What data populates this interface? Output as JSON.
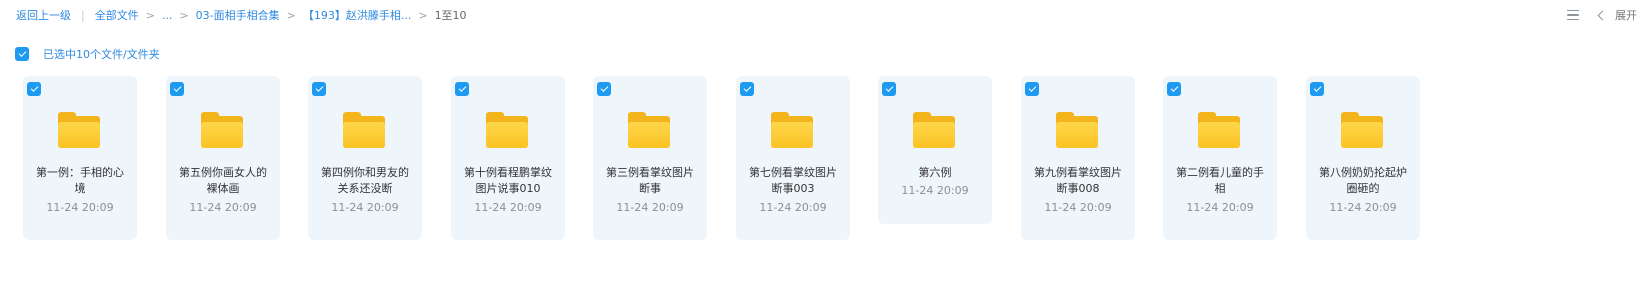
{
  "breadcrumb": {
    "back": "返回上一级",
    "divider": "|",
    "root": "全部文件",
    "ellipsis": "...",
    "level1": "03-面相手相合集",
    "level2": "【193】赵洪滕手相...",
    "sep": ">",
    "current": "1至10"
  },
  "top_right": {
    "list_icon": "list-view-icon",
    "chevron_icon": "chevron-left-icon",
    "expand_label": "展开"
  },
  "selection": {
    "checked": true,
    "label": "已选中10个文件/文件夹"
  },
  "colors": {
    "accent": "#1e9bf0",
    "link": "#2f8ae0",
    "card_bg": "#eef6fc",
    "folder": "#fbc324"
  },
  "files": [
    {
      "name": "第一例：手相的心境",
      "time": "11-24 20:09",
      "checked": true,
      "icon": "folder-icon"
    },
    {
      "name": "第五例你画女人的裸体画",
      "time": "11-24 20:09",
      "checked": true,
      "icon": "folder-icon"
    },
    {
      "name": "第四例你和男友的关系还没断",
      "time": "11-24 20:09",
      "checked": true,
      "icon": "folder-icon"
    },
    {
      "name": "第十例看程鹏掌纹图片说事010",
      "time": "11-24 20:09",
      "checked": true,
      "icon": "folder-icon"
    },
    {
      "name": "第三例看掌纹图片断事",
      "time": "11-24 20:09",
      "checked": true,
      "icon": "folder-icon"
    },
    {
      "name": "第七例看掌纹图片断事003",
      "time": "11-24 20:09",
      "checked": true,
      "icon": "folder-icon"
    },
    {
      "name": "第六例",
      "time": "11-24 20:09",
      "checked": true,
      "icon": "folder-icon"
    },
    {
      "name": "第九例看掌纹图片断事008",
      "time": "11-24 20:09",
      "checked": true,
      "icon": "folder-icon"
    },
    {
      "name": "第二例看儿童的手相",
      "time": "11-24 20:09",
      "checked": true,
      "icon": "folder-icon"
    },
    {
      "name": "第八例奶奶抡起炉圈砸的",
      "time": "11-24 20:09",
      "checked": true,
      "icon": "folder-icon"
    }
  ]
}
